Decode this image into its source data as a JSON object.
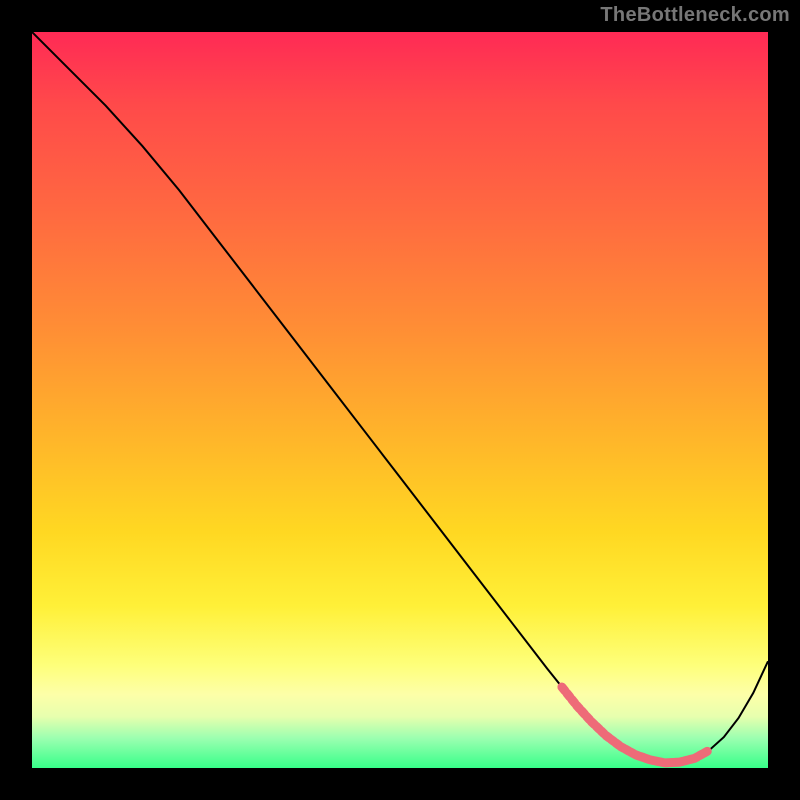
{
  "watermark": "TheBottleneck.com",
  "colors": {
    "background": "#000000",
    "gradient_top": "#ff2a55",
    "gradient_bottom": "#37ff89",
    "curve": "#000000",
    "highlight": "#ee6b78"
  },
  "chart_data": {
    "type": "line",
    "title": "",
    "xlabel": "",
    "ylabel": "",
    "xlim": [
      0,
      100
    ],
    "ylim": [
      0,
      100
    ],
    "x": [
      0,
      5,
      10,
      15,
      20,
      25,
      30,
      35,
      40,
      45,
      50,
      55,
      60,
      65,
      70,
      72,
      74,
      76,
      78,
      80,
      82,
      84,
      86,
      88,
      90,
      92,
      94,
      96,
      98,
      100
    ],
    "y": [
      100,
      95,
      90,
      84.5,
      78.5,
      72,
      65.5,
      59,
      52.5,
      46,
      39.5,
      33,
      26.5,
      20,
      13.5,
      11,
      8.5,
      6.3,
      4.4,
      2.9,
      1.8,
      1.1,
      0.7,
      0.8,
      1.3,
      2.4,
      4.2,
      6.8,
      10.2,
      14.5
    ],
    "highlight_segment": {
      "x": [
        72,
        74,
        76,
        78,
        80,
        82,
        84,
        86,
        88,
        90,
        92
      ],
      "y": [
        11,
        8.5,
        6.3,
        4.4,
        2.9,
        1.8,
        1.1,
        0.7,
        0.8,
        1.3,
        2.4
      ]
    }
  }
}
